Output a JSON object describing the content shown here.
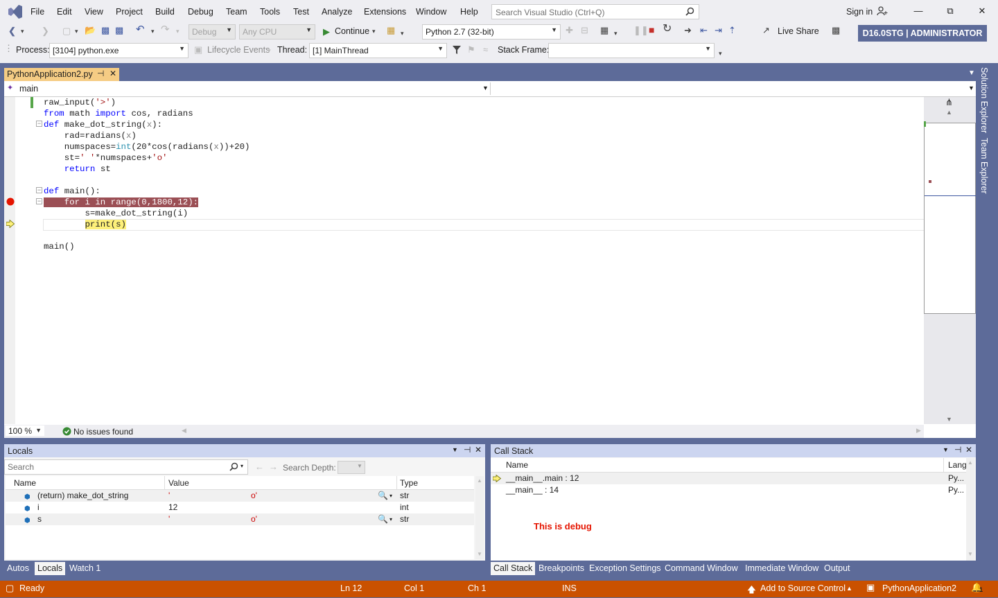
{
  "menubar": {
    "items": [
      "File",
      "Edit",
      "View",
      "Project",
      "Build",
      "Debug",
      "Team",
      "Tools",
      "Test",
      "Analyze",
      "Extensions",
      "Window",
      "Help"
    ],
    "search_placeholder": "Search Visual Studio (Ctrl+Q)",
    "sign_in": "Sign in"
  },
  "toolbar": {
    "config": "Debug",
    "platform": "Any CPU",
    "continue": "Continue",
    "environment": "Python 2.7 (32-bit)",
    "live_share": "Live Share",
    "admin_badge": "D16.0STG | ADMINISTRATOR"
  },
  "debug_location": {
    "process_label": "Process:",
    "process": "[3104] python.exe",
    "lifecycle": "Lifecycle Events",
    "thread_label": "Thread:",
    "thread": "[1] MainThread",
    "stack_frame_label": "Stack Frame:",
    "stack_frame": ""
  },
  "document": {
    "tab_title": "PythonApplication2.py",
    "nav_left": "main",
    "nav_right": ""
  },
  "code": [
    "raw_input('>')",
    "from math import cos, radians",
    "def make_dot_string(x):",
    "    rad=radians(x)",
    "    numspaces=int(20*cos(radians(x))+20)",
    "    st=' '*numspaces+'o'",
    "    return st",
    "",
    "def main():",
    "    for i in range(0,1800,12):",
    "        s=make_dot_string(i)",
    "        print(s)",
    "",
    "main()"
  ],
  "editor_status": {
    "zoom": "100 %",
    "issues": "No issues found"
  },
  "locals": {
    "title": "Locals",
    "search_placeholder": "Search",
    "search_depth_label": "Search Depth:",
    "columns": [
      "Name",
      "Value",
      "Type"
    ],
    "rows": [
      {
        "name": "(return) make_dot_string",
        "value_a": "'",
        "value_b": "o'",
        "type": "str"
      },
      {
        "name": "i",
        "value_a": "12",
        "value_b": "",
        "type": "int"
      },
      {
        "name": "s",
        "value_a": "'",
        "value_b": "o'",
        "type": "str"
      }
    ],
    "tabs": [
      "Autos",
      "Locals",
      "Watch 1"
    ]
  },
  "callstack": {
    "title": "Call Stack",
    "columns": [
      "Name",
      "Lang"
    ],
    "rows": [
      {
        "name": "__main__.main : 12",
        "lang": "Py..."
      },
      {
        "name": "__main__ : 14",
        "lang": "Py..."
      }
    ],
    "note": "This is debug",
    "tabs": [
      "Call Stack",
      "Breakpoints",
      "Exception Settings",
      "Command Window",
      "Immediate Window",
      "Output"
    ]
  },
  "side_tabs": [
    "Solution Explorer",
    "Team Explorer"
  ],
  "statusbar": {
    "ready": "Ready",
    "ln": "Ln 12",
    "col": "Col 1",
    "ch": "Ch 1",
    "ins": "INS",
    "source_control": "Add to Source Control",
    "project": "PythonApplication2",
    "notifications": "1"
  },
  "colors": {
    "accent": "#5d6b99",
    "status": "#ca5100",
    "breakpoint": "#e51400",
    "breakpoint_line": "#9b4f55",
    "current_line": "#fdf07a",
    "note": "#e51400"
  }
}
